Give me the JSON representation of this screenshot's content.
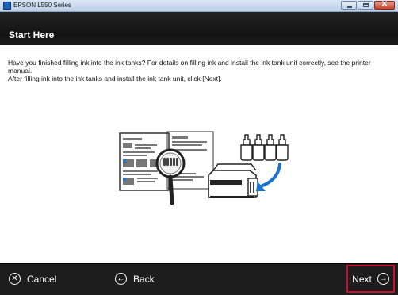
{
  "window": {
    "title": "EPSON L550 Series",
    "close_glyph": "✕"
  },
  "header": {
    "title": "Start Here"
  },
  "content": {
    "line1": "Have you finished filling ink into the ink tanks? For details on filling ink and install the ink tank unit correctly, see the printer manual.",
    "line2": "After filling ink into the ink tanks and install the ink tank unit, click [Next]."
  },
  "footer": {
    "cancel_label": "Cancel",
    "back_label": "Back",
    "next_label": "Next",
    "cancel_icon_glyph": "✕",
    "back_icon_glyph": "←",
    "next_icon_glyph": "→"
  },
  "colors": {
    "header_bg": "#1b1b1b",
    "footer_bg": "#1d1d1d",
    "next_highlight": "#c8102e",
    "accent_blue": "#1e74c9"
  },
  "icons": [
    "epson-app-icon",
    "minimize-icon",
    "maximize-icon",
    "close-icon",
    "cancel-circle-x-icon",
    "back-arrow-icon",
    "next-arrow-icon",
    "manual-magnifier-illustration",
    "printer-ink-bottles-illustration"
  ]
}
